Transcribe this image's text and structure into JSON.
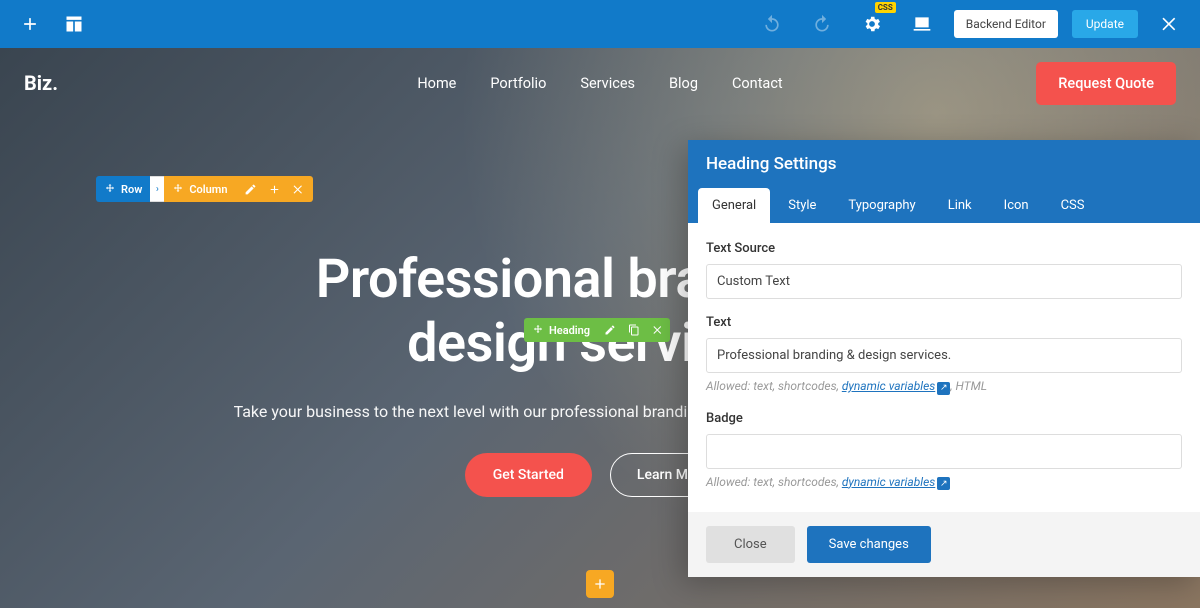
{
  "toolbar": {
    "backend_label": "Backend Editor",
    "update_label": "Update",
    "css_badge": "CSS"
  },
  "site": {
    "logo": "Biz.",
    "nav": [
      "Home",
      "Portfolio",
      "Services",
      "Blog",
      "Contact"
    ],
    "cta": "Request Quote"
  },
  "crumbs": {
    "row": "Row",
    "column": "Column"
  },
  "hero": {
    "title_line1": "Professional branding &",
    "title_line2": "design services.",
    "subtitle": "Take your business to the next level with our professional branding, web design and marketing services.",
    "primary": "Get Started",
    "secondary": "Learn More"
  },
  "element_toolbar": {
    "label": "Heading"
  },
  "panel": {
    "title": "Heading Settings",
    "tabs": [
      "General",
      "Style",
      "Typography",
      "Link",
      "Icon",
      "CSS"
    ],
    "active_tab": 0,
    "fields": {
      "text_source_label": "Text Source",
      "text_source_value": "Custom Text",
      "text_label": "Text",
      "text_value": "Professional branding & design services.",
      "text_help_prefix": "Allowed: text, shortcodes, ",
      "text_help_link": "dynamic variables",
      "text_help_suffix": ", HTML",
      "badge_label": "Badge",
      "badge_value": "",
      "badge_help_prefix": "Allowed: text, shortcodes, ",
      "badge_help_link": "dynamic variables"
    },
    "footer": {
      "close": "Close",
      "save": "Save changes"
    }
  }
}
